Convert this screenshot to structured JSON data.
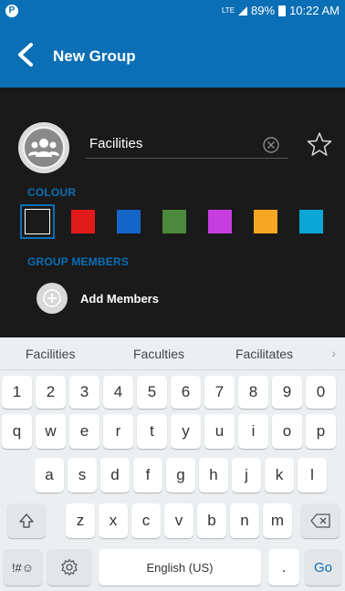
{
  "status_bar": {
    "app_icon": "P",
    "network": "LTE",
    "battery": "89%",
    "time": "10:22 AM"
  },
  "action_bar": {
    "title": "New Group"
  },
  "form": {
    "group_name": "Facilities",
    "colour_label": "COLOUR",
    "members_label": "GROUP MEMBERS",
    "add_members_label": "Add Members",
    "swatch_colors": [
      "#1a1a1a",
      "#e21a1a",
      "#1565c8",
      "#4a8a3a",
      "#c63de0",
      "#f5a623",
      "#0aa6d6"
    ],
    "accent": "#0b6fb5"
  },
  "keyboard": {
    "suggestions": [
      "Facilities",
      "Faculties",
      "Facilitates"
    ],
    "number_row": [
      "1",
      "2",
      "3",
      "4",
      "5",
      "6",
      "7",
      "8",
      "9",
      "0"
    ],
    "row1": [
      "q",
      "w",
      "e",
      "r",
      "t",
      "y",
      "u",
      "i",
      "o",
      "p"
    ],
    "row2": [
      "a",
      "s",
      "d",
      "f",
      "g",
      "h",
      "j",
      "k",
      "l"
    ],
    "row3": [
      "z",
      "x",
      "c",
      "v",
      "b",
      "n",
      "m"
    ],
    "symbols_key": "!#☺",
    "space_label": "English (US)",
    "period_key": ".",
    "go_key": "Go"
  }
}
